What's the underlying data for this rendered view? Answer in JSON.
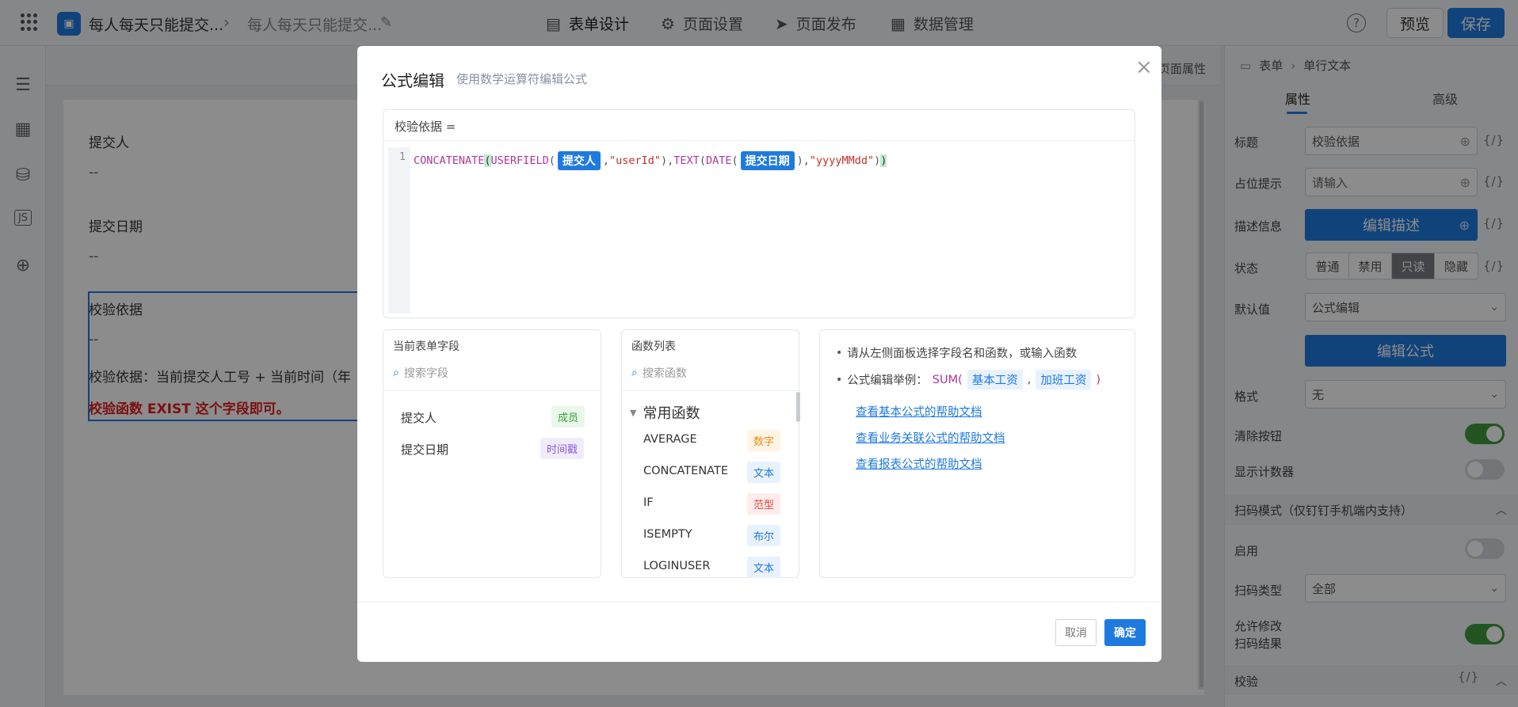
{
  "header": {
    "app_title": "每人每天只能提交...",
    "form_title": "每人每天只能提交...",
    "tabs": [
      {
        "label": "表单设计",
        "icon": "document-icon"
      },
      {
        "label": "页面设置",
        "icon": "gear-icon"
      },
      {
        "label": "页面发布",
        "icon": "send-icon"
      },
      {
        "label": "数据管理",
        "icon": "table-icon"
      }
    ],
    "help_label": "?",
    "preview_label": "预览",
    "save_label": "保存"
  },
  "canvas": {
    "header_label": "页面属性",
    "fields": [
      {
        "label": "提交人",
        "value": "--"
      },
      {
        "label": "提交日期",
        "value": "--"
      },
      {
        "label": "校验依据",
        "value": "--"
      }
    ],
    "description": "校验依据：当前提交人工号 + 当前时间（年",
    "red_note": "校验函数 EXIST 这个字段即可。"
  },
  "right_panel": {
    "breadcrumb": [
      "表单",
      "单行文本"
    ],
    "tabs": [
      "属性",
      "高级"
    ],
    "props": {
      "title_label": "标题",
      "title_value": "校验依据",
      "placeholder_label": "占位提示",
      "placeholder_value": "请输入",
      "desc_label": "描述信息",
      "desc_button": "编辑描述",
      "status_label": "状态",
      "status_options": [
        "普通",
        "禁用",
        "只读",
        "隐藏"
      ],
      "default_label": "默认值",
      "default_value": "公式编辑",
      "formula_button": "编辑公式",
      "format_label": "格式",
      "format_value": "无",
      "clear_label": "清除按钮",
      "counter_label": "显示计数器",
      "scan_section": "扫码模式（仅钉钉手机端内支持）",
      "enable_label": "启用",
      "scan_type_label": "扫码类型",
      "scan_type_value": "全部",
      "allow_edit_label_1": "允许修改",
      "allow_edit_label_2": "扫码结果",
      "validate_section": "校验",
      "code_tag": "{/}"
    }
  },
  "modal": {
    "title": "公式编辑",
    "subtitle": "使用数学运算符编辑公式",
    "close": "×",
    "editor_label": "校验依据 =",
    "line_number": "1",
    "code": {
      "fn1": "CONCATENATE",
      "open1": "(",
      "fn2": "USERFIELD",
      "open2": "(",
      "pill1": "提交人",
      "sep1": ",",
      "str1": "\"userId\"",
      "close2": ")",
      "sep2": ",",
      "fn3": "TEXT",
      "open3": "(",
      "fn4": "DATE",
      "open4": "(",
      "pill2": "提交日期",
      "close4": ")",
      "sep3": ",",
      "str2": "\"yyyyMMdd\"",
      "close3": ")",
      "close1": ")"
    },
    "fields_panel": {
      "title": "当前表单字段",
      "search_placeholder": "搜索字段",
      "items": [
        {
          "name": "提交人",
          "tag": "成员"
        },
        {
          "name": "提交日期",
          "tag": "时间戳"
        }
      ]
    },
    "functions_panel": {
      "title": "函数列表",
      "search_placeholder": "搜索函数",
      "group": "常用函数",
      "items": [
        {
          "name": "AVERAGE",
          "tag": "数字"
        },
        {
          "name": "CONCATENATE",
          "tag": "文本"
        },
        {
          "name": "IF",
          "tag": "范型"
        },
        {
          "name": "ISEMPTY",
          "tag": "布尔"
        },
        {
          "name": "LOGINUSER",
          "tag": "文本"
        }
      ]
    },
    "help_panel": {
      "line1": "请从左侧面板选择字段名和函数，或输入函数",
      "line2_prefix": "公式编辑举例：",
      "example_fn": "SUM(",
      "example_arg1": "基本工资",
      "example_sep": ",",
      "example_arg2": "加班工资",
      "example_close": ")",
      "links": [
        "查看基本公式的帮助文档",
        "查看业务关联公式的帮助文档",
        "查看报表公式的帮助文档"
      ]
    },
    "cancel_label": "取消",
    "ok_label": "确定"
  }
}
